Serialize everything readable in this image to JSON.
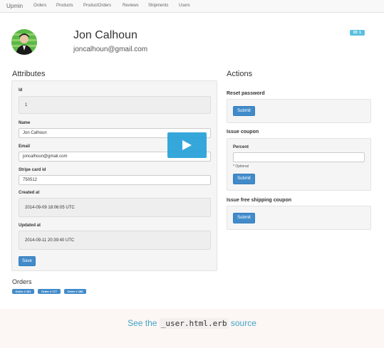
{
  "navbar": {
    "brand": "Upmin",
    "items": [
      "Orders",
      "Products",
      "ProductOrders",
      "Reviews",
      "Shipments",
      "Users"
    ]
  },
  "user": {
    "name": "Jon Calhoun",
    "email": "joncalhoun@gmail.com",
    "id_badge": "ID: 1"
  },
  "attributes": {
    "title": "Attributes",
    "id_label": "Id",
    "id_value": "1",
    "name_label": "Name",
    "name_value": "Jon Calhoun",
    "email_label": "Email",
    "email_value": "joncalhoun@gmail.com",
    "stripe_label": "Stripe card id",
    "stripe_value": "750512",
    "created_label": "Created at",
    "created_value": "2014-09-09 18:06:05 UTC",
    "updated_label": "Updated at",
    "updated_value": "2014-09-11 20:39:40 UTC",
    "save_label": "Save"
  },
  "actions": {
    "title": "Actions",
    "reset_label": "Reset password",
    "reset_submit": "Submit",
    "coupon_label": "Issue coupon",
    "percent_label": "Percent",
    "percent_value": "",
    "percent_help": "* Optional",
    "coupon_submit": "Submit",
    "shipping_label": "Issue free shipping coupon",
    "shipping_submit": "Submit"
  },
  "orders": {
    "title": "Orders",
    "badges": [
      "Order # 101",
      "Order # 177",
      "Order # 186"
    ]
  },
  "footer": {
    "prefix": "See the",
    "code": "_user.html.erb",
    "suffix": "source"
  },
  "colors": {
    "primary": "#428bca",
    "info": "#5bc0de",
    "play_overlay": "#25a0d8",
    "footer_text": "#42a5c6"
  },
  "icons": {
    "play": "play-icon"
  }
}
